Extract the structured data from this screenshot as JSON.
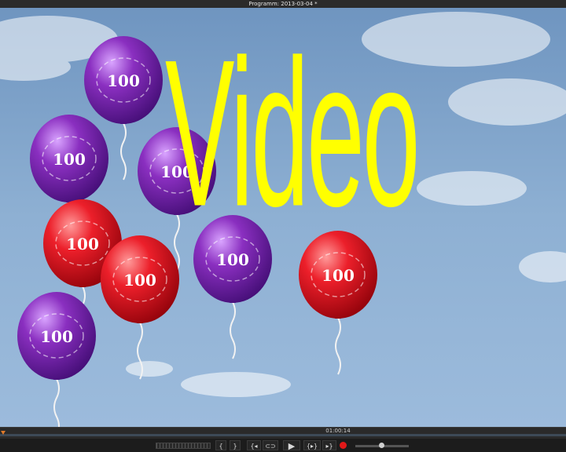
{
  "window": {
    "title": "Programm: 2013-03-04 *"
  },
  "preview": {
    "title_text": "Video",
    "title_color": "#ffff00",
    "balloon_label": "100",
    "balloon_colors": {
      "purple": "#7a2aa8",
      "red": "#e0202a"
    }
  },
  "timeline": {
    "timecode": "01:00:14"
  },
  "controls": {
    "go_start": "{",
    "go_end": "}",
    "step_back": "{◂",
    "loop": "⊂⊃",
    "play": "▶",
    "step_forward": "{▸}",
    "jump_forward": "▸}"
  }
}
